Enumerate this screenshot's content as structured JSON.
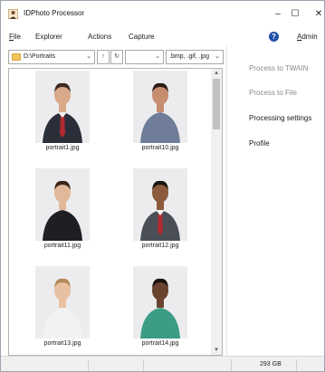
{
  "window": {
    "title": "IDPhoto Processor",
    "controls": {
      "minimize": "–",
      "maximize": "☐",
      "close": "✕"
    }
  },
  "menu": {
    "file": "File",
    "explorer": "Explorer",
    "actions": "Actions",
    "capture": "Capture",
    "help_icon": "?",
    "admin": "Admin"
  },
  "explorer": {
    "path": "D:\\Portraits",
    "filter_value": "",
    "extensions": ".bmp, .gif, .jpg",
    "up_button": "↑",
    "refresh_button": "↻",
    "files": [
      {
        "name": "portrait1.jpg",
        "shirt": "#2b2f3a",
        "tie": "#b02a30",
        "skin": "#d9a98a",
        "hair": "#3b2a20"
      },
      {
        "name": "portrait10.jpg",
        "shirt": "#6f7d99",
        "tie": "",
        "skin": "#c68e6f",
        "hair": "#2a1e18"
      },
      {
        "name": "portrait11.jpg",
        "shirt": "#1e1e24",
        "tie": "",
        "skin": "#e2b89a",
        "hair": "#3a2618"
      },
      {
        "name": "portrait12.jpg",
        "shirt": "#4a4e56",
        "tie": "#b02a30",
        "skin": "#8c5a3c",
        "hair": "#1c1410"
      },
      {
        "name": "portrait13.jpg",
        "shirt": "#f2f2f4",
        "tie": "",
        "skin": "#e8c0a2",
        "hair": "#b58a5a"
      },
      {
        "name": "portrait14.jpg",
        "shirt": "#3d9c86",
        "tie": "",
        "skin": "#6a432e",
        "hair": "#1a120e"
      }
    ]
  },
  "actions_panel": {
    "process_twain": "Process to TWAIN",
    "process_file": "Process to File",
    "processing_settings": "Processing settings",
    "profile": "Profile"
  },
  "status": {
    "disk_free": "293 GB"
  }
}
